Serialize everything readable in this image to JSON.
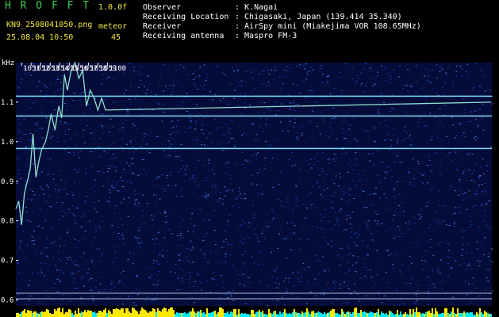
{
  "header": {
    "app_title": "H R O F F T",
    "version": "1.0.0f",
    "filename": "KN9_2508041050.png",
    "meteor_label": "meteor",
    "datetime": "25.08.04 10:50",
    "meteor_count": "45",
    "info": [
      {
        "label": "Observer",
        "value": ": K.Nagai"
      },
      {
        "label": "Receiving Location",
        "value": ": Chigasaki, Japan (139.414 35.340)"
      },
      {
        "label": "Receiver",
        "value": ": AirSpy mini (Miakejima VOR 108.65MHz)"
      },
      {
        "label": "Receiving antenna",
        "value": ": Maspro FM-3"
      }
    ]
  },
  "colors": {
    "background": "#000000",
    "noise_dark": "#0b1f6b",
    "noise_mid": "#1a40b0",
    "noise_bright": "#4a7ae0",
    "trace": "#8fe0d0",
    "reference_line": "#7fe6ff",
    "marker_line": "#cfe8ff",
    "meteor_bar_yellow": "#ffe800",
    "meteor_bar_cyan": "#00e8ff"
  },
  "chart_data": {
    "type": "heatmap",
    "title": "",
    "ylabel": "kHz",
    "xlabel": "",
    "x_ticks": [
      "1051",
      "1052",
      "1053",
      "1054",
      "1055",
      "1056",
      "1057",
      "1058",
      "1059",
      "1100"
    ],
    "y_ticks": [
      "1.1",
      "1.0",
      "0.9",
      "0.8",
      "0.7",
      "0.6"
    ],
    "ylim": [
      0.585,
      1.2
    ],
    "xlim": [
      1050.4,
      1100.3
    ],
    "reference_lines_khz": [
      1.115,
      1.065,
      0.983,
      0.617,
      0.603
    ],
    "doppler_trace": {
      "name": "",
      "x": [
        1050.4,
        1050.7,
        1051.0,
        1051.3,
        1051.6,
        1051.9,
        1052.2,
        1052.5,
        1052.8,
        1053.1,
        1053.5,
        1053.8,
        1054.1,
        1054.5,
        1054.9,
        1055.2,
        1055.5,
        1055.8,
        1056.2,
        1056.6,
        1057.0,
        1057.4,
        1057.8,
        1058.2,
        1058.6,
        1059.0,
        1059.4,
        1059.8,
        1100.2
      ],
      "y": [
        0.83,
        0.85,
        0.79,
        0.87,
        0.9,
        0.93,
        1.02,
        0.91,
        0.95,
        0.98,
        1.0,
        1.03,
        1.07,
        1.03,
        1.09,
        1.06,
        1.17,
        1.13,
        1.18,
        1.2,
        1.16,
        1.18,
        1.09,
        1.13,
        1.11,
        1.08,
        1.11,
        1.08,
        1.1
      ]
    },
    "meteor_activity_bars": {
      "x_start": 1050.4,
      "x_end": 1100.3
    },
    "grid": false
  }
}
